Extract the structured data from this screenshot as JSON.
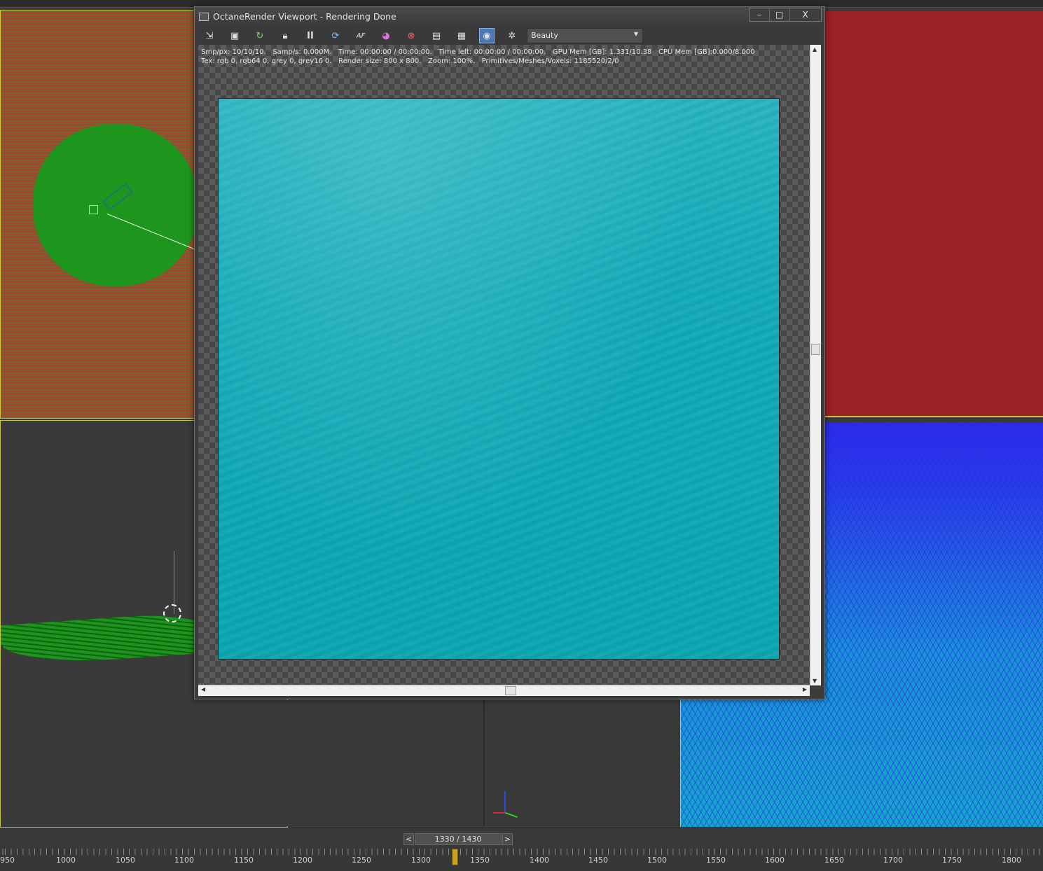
{
  "window": {
    "title": "OctaneRender Viewport - Rendering Done",
    "buttons": {
      "minimize": "–",
      "maximize": "□",
      "close": "X"
    }
  },
  "toolbar": {
    "icons": [
      "export-icon",
      "clipboard-icon",
      "refresh-icon",
      "lock-icon",
      "pause-icon",
      "reset-icon",
      "autofocus-icon",
      "color-picker-icon",
      "clay-mode-icon",
      "region-icon",
      "film-region-icon",
      "camera-icon",
      "settings-icon"
    ],
    "pause_label": "II",
    "af_label": "AF",
    "pass_dropdown": {
      "value": "Beauty",
      "arrow": "▼"
    }
  },
  "stats": {
    "line1": "Smp/px: 10/10/10.   Samp/s: 0.000M.   Time: 00:00:00 / 00:00:00.   Time left: 00:00:00 / 00:00:00.   GPU Mem [GB]: 1.331/10.38   CPU Mem [GB]:0.000/8.000",
    "line2": "Tex: rgb 0, rgb64 0, grey 0, grey16 0.   Render size: 800 x 800.   Zoom: 100%.   Primitives/Meshes/Voxels: 1185520/2/0"
  },
  "render": {
    "color": "#12aab6"
  },
  "scrollbars": {
    "up": "▲",
    "down": "▼",
    "left": "◀",
    "right": "▶"
  },
  "timeslider": {
    "prev": "<",
    "next": ">",
    "frame": "1330 / 1430"
  },
  "trackbar": {
    "labels": [
      "950",
      "1000",
      "1050",
      "1100",
      "1150",
      "1200",
      "1250",
      "1300",
      "1350",
      "1400",
      "1450",
      "1500",
      "1550",
      "1600",
      "1650",
      "1700",
      "1750",
      "1800"
    ]
  },
  "colors": {
    "active_tool": "#4a78b8",
    "viewport_border": "#c8c840",
    "playhead": "#c8a020"
  }
}
